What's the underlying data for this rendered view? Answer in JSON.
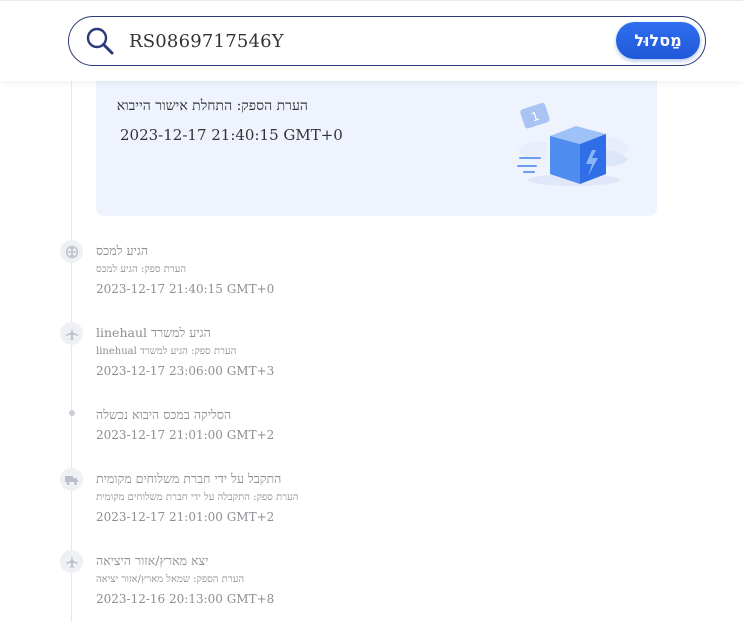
{
  "search": {
    "value": "RS0869717546Y",
    "button_label": "מַסלוּל"
  },
  "latest_event": {
    "note": "הערת הספק: התחלת אישור הייבוא",
    "time": "2023-12-17 21:40:15 GMT+0",
    "illustration_badge": "1",
    "icon": "package-box-icon"
  },
  "events": [
    {
      "title": "הגיע למכס",
      "note": "הערת ספק: הגיע למכס",
      "time": "2023-12-17 21:40:15 GMT+0",
      "icon": "customs-icon"
    },
    {
      "title": "linehaul הגיע למשרד",
      "note": "linehual הערת ספק: הגיע למשרד",
      "time": "2023-12-17 23:06:00 GMT+3",
      "icon": "airplane-icon"
    },
    {
      "title": "הסליקה במכס היבוא נכשלה",
      "note": "",
      "time": "2023-12-17 21:01:00 GMT+2",
      "icon": "dot-icon"
    },
    {
      "title": "התקבל על ידי חברת משלוחים מקומית",
      "note": "הערת ספק: התקבלה על ידי חברת משלוחים מקומית",
      "time": "2023-12-17 21:01:00 GMT+2",
      "icon": "truck-icon"
    },
    {
      "title": "יצא מארץ/אזור היציאה",
      "note": "הערת הספק: שמאל מארץ/אזור יציאה",
      "time": "2023-12-16 20:13:00 GMT+8",
      "icon": "airplane-icon"
    }
  ],
  "colors": {
    "accent": "#1f58d8",
    "search_border": "#2b3a7a",
    "card_background": "#eef3fd",
    "muted_text": "#8e8e94"
  }
}
